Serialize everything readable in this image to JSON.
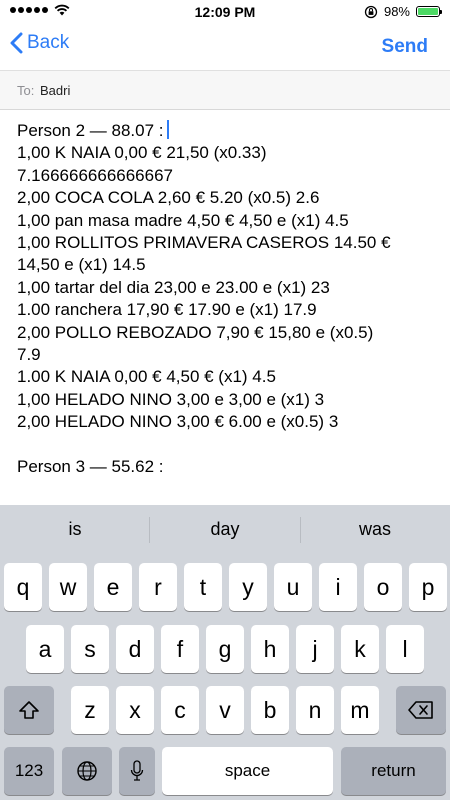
{
  "status_bar": {
    "time": "12:09 PM",
    "battery": "98%",
    "battery_level": 0.98
  },
  "nav": {
    "back_label": "Back",
    "send_label": "Send"
  },
  "to_field": {
    "label": "To:",
    "value": "Badri"
  },
  "message_lines": [
    "Person 2 — 88.07 :",
    "1,00 K NAIA 0,00 € 21,50 (x0.33)",
    "7.166666666666667",
    "2,00 COCA COLA 2,60 € 5.20 (x0.5) 2.6",
    "1,00 pan masa madre 4,50 € 4,50 e (x1) 4.5",
    "1,00 ROLLITOS PRIMAVERA CASEROS 14.50 €",
    "14,50 e (x1) 14.5",
    "1,00 tartar del dia 23,00 e 23.00 e (x1) 23",
    "1.00 ranchera 17,90 € 17.90 e (x1) 17.9",
    "2,00 POLLO REBOZADO 7,90 € 15,80 e (x0.5)",
    "7.9",
    "1.00 K NAIA 0,00 € 4,50 € (x1) 4.5",
    "1,00 HELADO NINO 3,00 e 3,00 e (x1) 3",
    "2,00 HELADO NINO 3,00 € 6.00 e (x0.5) 3",
    "",
    "Person 3 — 55.62 :"
  ],
  "suggestions": [
    "is",
    "day",
    "was"
  ],
  "keyboard": {
    "row1": [
      "q",
      "w",
      "e",
      "r",
      "t",
      "y",
      "u",
      "i",
      "o",
      "p"
    ],
    "row2": [
      "a",
      "s",
      "d",
      "f",
      "g",
      "h",
      "j",
      "k",
      "l"
    ],
    "row3": [
      "z",
      "x",
      "c",
      "v",
      "b",
      "n",
      "m"
    ],
    "numbers_label": "123",
    "space_label": "space",
    "return_label": "return"
  },
  "icons": {
    "signal": "cellular-signal-icon",
    "wifi": "wifi-icon",
    "lock": "orientation-lock-icon",
    "battery": "battery-icon",
    "back": "chevron-left-icon",
    "shift": "shift-icon",
    "delete": "delete-icon",
    "globe": "globe-icon",
    "mic": "microphone-icon"
  },
  "colors": {
    "accent": "#2d7cf6",
    "battery_fill": "#4cd964",
    "keyboard_bg": "#d1d5db"
  }
}
